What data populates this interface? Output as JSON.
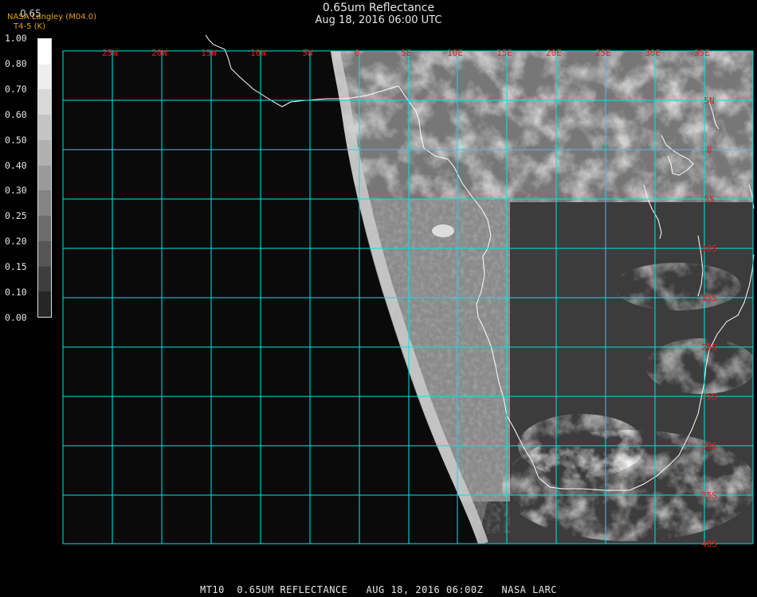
{
  "header": {
    "title": "0.65um Reflectance",
    "datetime": "Aug 18, 2016 06:00 UTC",
    "credit": "NASA Langley (M04.0)",
    "credit_sub": "T4-5 (K)",
    "colorbar_top_label": "0.65"
  },
  "colorbar": {
    "labels": [
      "1.00",
      "0.80",
      "0.70",
      "0.60",
      "0.50",
      "0.40",
      "0.30",
      "0.25",
      "0.20",
      "0.15",
      "0.10",
      "0.00"
    ],
    "gray_levels": [
      "#ffffff",
      "#eeeeee",
      "#d8d8d8",
      "#c4c4c4",
      "#b0b0b0",
      "#9a9a9a",
      "#848484",
      "#6c6c6c",
      "#565656",
      "#3e3e3e",
      "#262626"
    ]
  },
  "map": {
    "grid_color": "#00e5e5",
    "label_color": "#e02020",
    "coast_color": "#ffffff",
    "lon_labels": [
      "25W",
      "20W",
      "15W",
      "10W",
      "5W",
      "0",
      "5E",
      "10E",
      "15E",
      "20E",
      "25E",
      "30E",
      "35E"
    ],
    "lat_labels": [
      "5N",
      "0",
      "5S",
      "10S",
      "15S",
      "20S",
      "25S",
      "30S",
      "35S",
      "40S"
    ]
  },
  "footer": {
    "text": "MT10  0.65UM REFLECTANCE   AUG 18, 2016 06:00Z   NASA LARC"
  }
}
